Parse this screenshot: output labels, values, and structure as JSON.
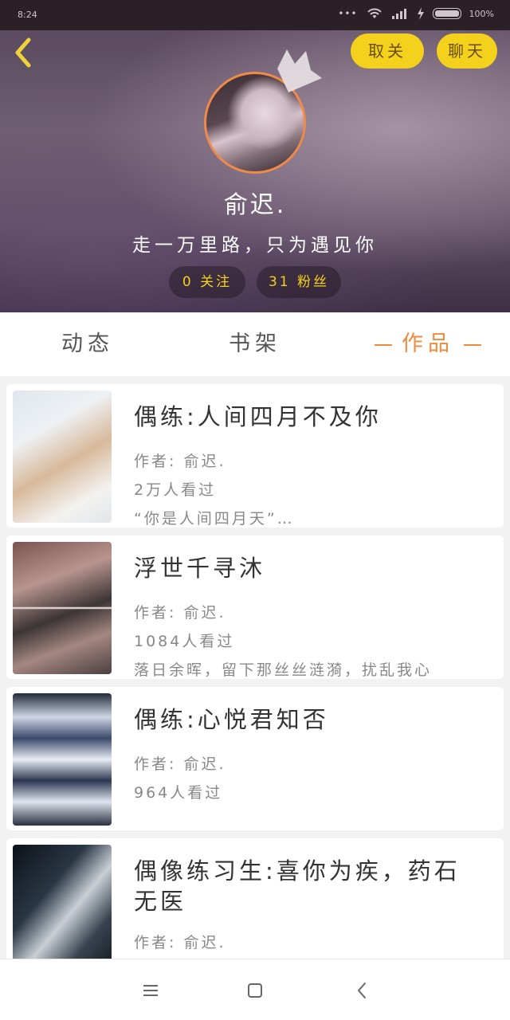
{
  "status_bar": {
    "time": "8:24",
    "dots": "•••",
    "battery": "100%"
  },
  "header": {
    "unfollow_label": "取关",
    "chat_label": "聊天",
    "username": "俞迟.",
    "bio": "走一万里路，只为遇见你",
    "following": "0 关注",
    "fans": "31 粉丝"
  },
  "tabs": [
    {
      "label": "动态",
      "active": false
    },
    {
      "label": "书架",
      "active": false
    },
    {
      "label": "作品",
      "active": true
    }
  ],
  "works": [
    {
      "title": "偶练:人间四月不及你",
      "author": "作者: 俞迟.",
      "views": "2万人看过",
      "excerpt": "“你是人间四月天”…"
    },
    {
      "title": "浮世千寻沐",
      "author": "作者: 俞迟.",
      "views": "1084人看过",
      "excerpt": "落日余晖，留下那丝丝涟漪，扰乱我心"
    },
    {
      "title": "偶练:心悦君知否",
      "author": "作者: 俞迟.",
      "views": "964人看过",
      "excerpt": ""
    },
    {
      "title": "偶像练习生:喜你为疾，药石无医",
      "author": "作者: 俞迟.",
      "views": "",
      "excerpt": ""
    }
  ],
  "colors": {
    "accent_yellow": "#f4d11c",
    "accent_orange": "#f08a3c",
    "background": "#f2f2f2"
  },
  "icons": [
    "back-chevron-icon",
    "crown-icon",
    "wifi-icon",
    "signal-icon",
    "menu-icon",
    "home-icon",
    "back-icon"
  ]
}
